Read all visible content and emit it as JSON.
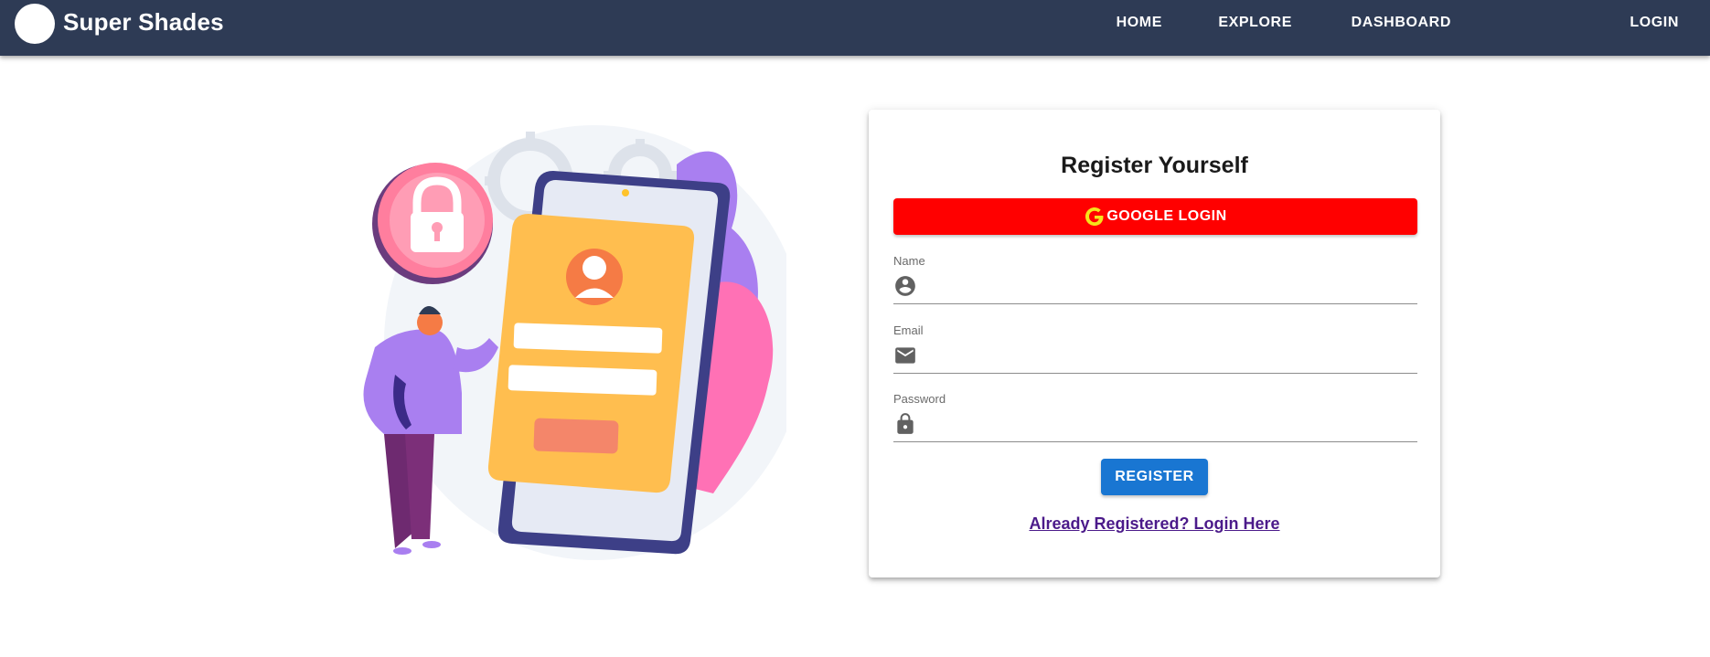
{
  "app": {
    "brand_name": "Super Shades"
  },
  "nav": {
    "items": [
      "HOME",
      "EXPLORE",
      "DASHBOARD",
      "LOGIN"
    ]
  },
  "form": {
    "title": "Register Yourself",
    "google_button_label": "GOOGLE LOGIN",
    "fields": [
      {
        "label": "Name",
        "icon": "account-circle-icon",
        "value": ""
      },
      {
        "label": "Email",
        "icon": "mail-icon",
        "value": ""
      },
      {
        "label": "Password",
        "icon": "lock-icon",
        "value": ""
      }
    ],
    "register_button_label": "REGISTER",
    "login_link_text": "Already Registered? Login Here"
  },
  "colors": {
    "appbar": "#2e3b55",
    "google_button": "#ff0000",
    "register_button": "#1976d2",
    "link": "#4b1a8a"
  }
}
